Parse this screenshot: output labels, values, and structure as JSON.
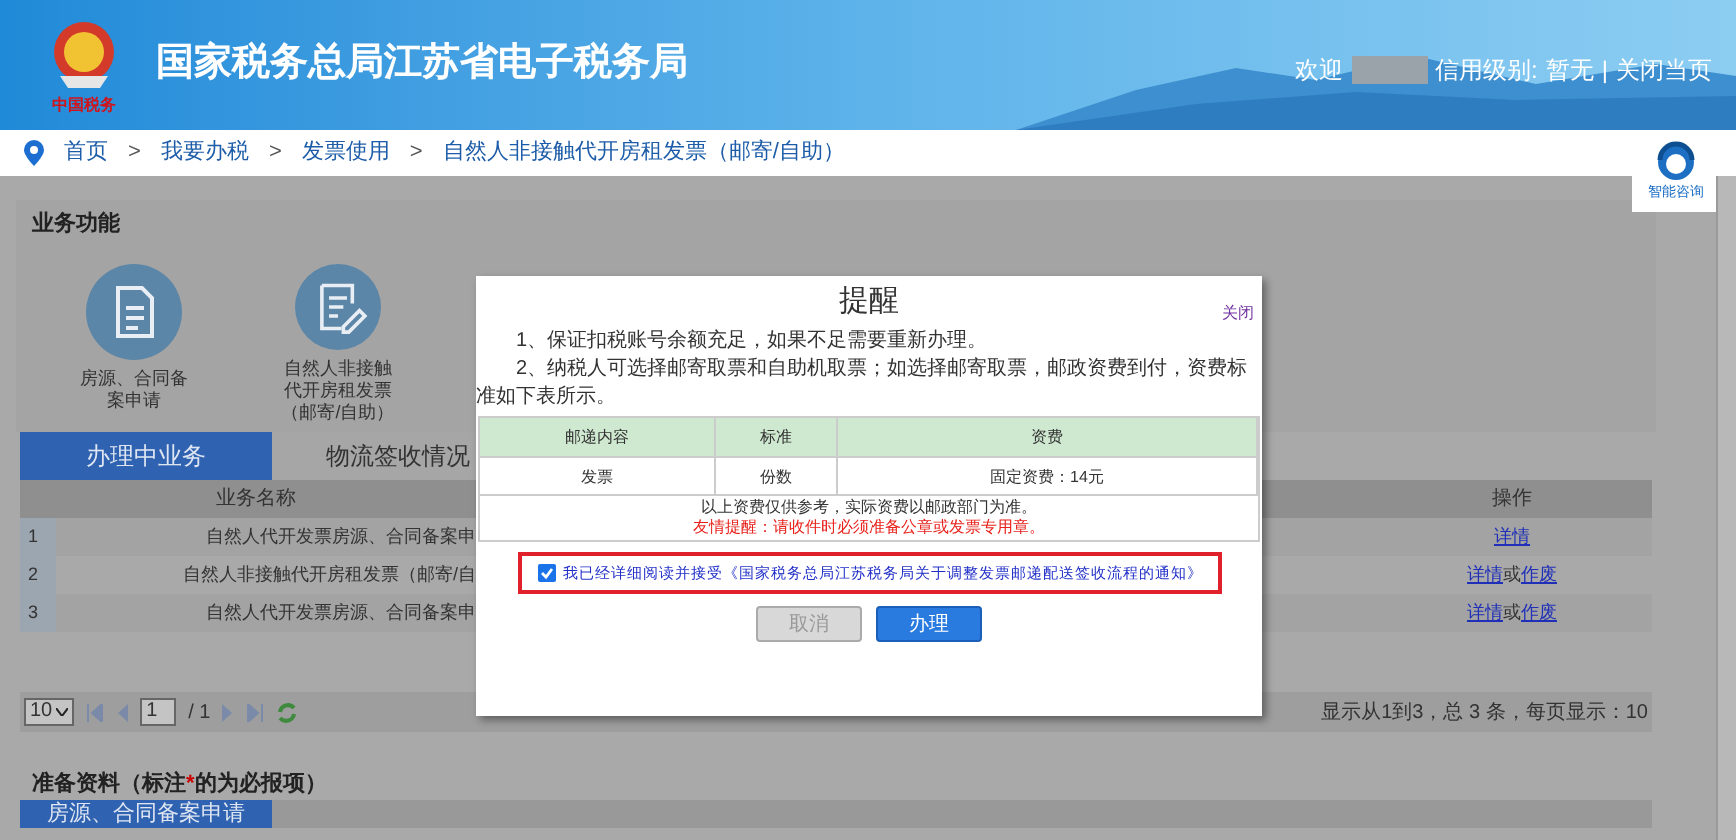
{
  "header": {
    "title": "国家税务总局江苏省电子税务局",
    "logo_text": "中国税务",
    "welcome": "欢迎",
    "credit_label": "信用级别:",
    "credit_value": "暂无",
    "separator": "|",
    "close_page": "关闭当页"
  },
  "breadcrumb": [
    "首页",
    "我要办税",
    "发票使用",
    "自然人非接触代开房租发票（邮寄/自助）"
  ],
  "breadcrumb_separator": ">",
  "assistant": {
    "label": "智能咨询"
  },
  "functions": {
    "title": "业务功能",
    "items": [
      {
        "kind": "document",
        "label": "房源、合同备案申请"
      },
      {
        "kind": "edit",
        "label": "自然人非接触代开房租发票（邮寄/自助）"
      }
    ]
  },
  "tabs": [
    {
      "label": "办理中业务",
      "selected": true
    },
    {
      "label": "物流签收情况",
      "selected": false
    }
  ],
  "table": {
    "columns": [
      "业务名称",
      "操作"
    ],
    "rows": [
      {
        "index": "1",
        "name": "自然人代开发票房源、合同备案申",
        "actions": [
          "详情"
        ]
      },
      {
        "index": "2",
        "name": "自然人非接触代开房租发票（邮寄/自",
        "actions": [
          "详情",
          "或",
          "作废"
        ]
      },
      {
        "index": "3",
        "name": "自然人代开发票房源、合同备案申",
        "actions": [
          "详情",
          "或",
          "作废"
        ]
      }
    ]
  },
  "pager": {
    "page_size": "10",
    "page": "1",
    "total_pages": "/ 1",
    "summary": "显示从1到3，总 3 条，每页显示：10"
  },
  "materials": {
    "title_before": "准备资料（标注",
    "required_mark": "*",
    "title_after": "的为必报项）",
    "tabs": [
      {
        "label": "房源、合同备案申请",
        "selected": true
      }
    ]
  },
  "dialog": {
    "title": "提醒",
    "close": "关闭",
    "paragraphs": [
      "1、保证扣税账号余额充足，如果不足需要重新办理。",
      "2、纳税人可选择邮寄取票和自助机取票；如选择邮寄取票，邮政资费到付，资费标准如下表所示。"
    ],
    "fee_table": {
      "columns": [
        "邮递内容",
        "标准",
        "资费"
      ],
      "rows": [
        [
          "发票",
          "份数",
          "固定资费：14元"
        ]
      ]
    },
    "note": "以上资费仅供参考，实际资费以邮政部门为准。",
    "warning": "友情提醒：请收件时必须准备公章或发票专用章。",
    "agreement": {
      "checked": true,
      "text": "我已经详细阅读并接受《国家税务总局江苏税务局关于调整发票邮递配送签收流程的通知》"
    },
    "buttons": [
      {
        "label": "取消",
        "disabled": true
      },
      {
        "label": "办理",
        "disabled": false
      }
    ]
  }
}
